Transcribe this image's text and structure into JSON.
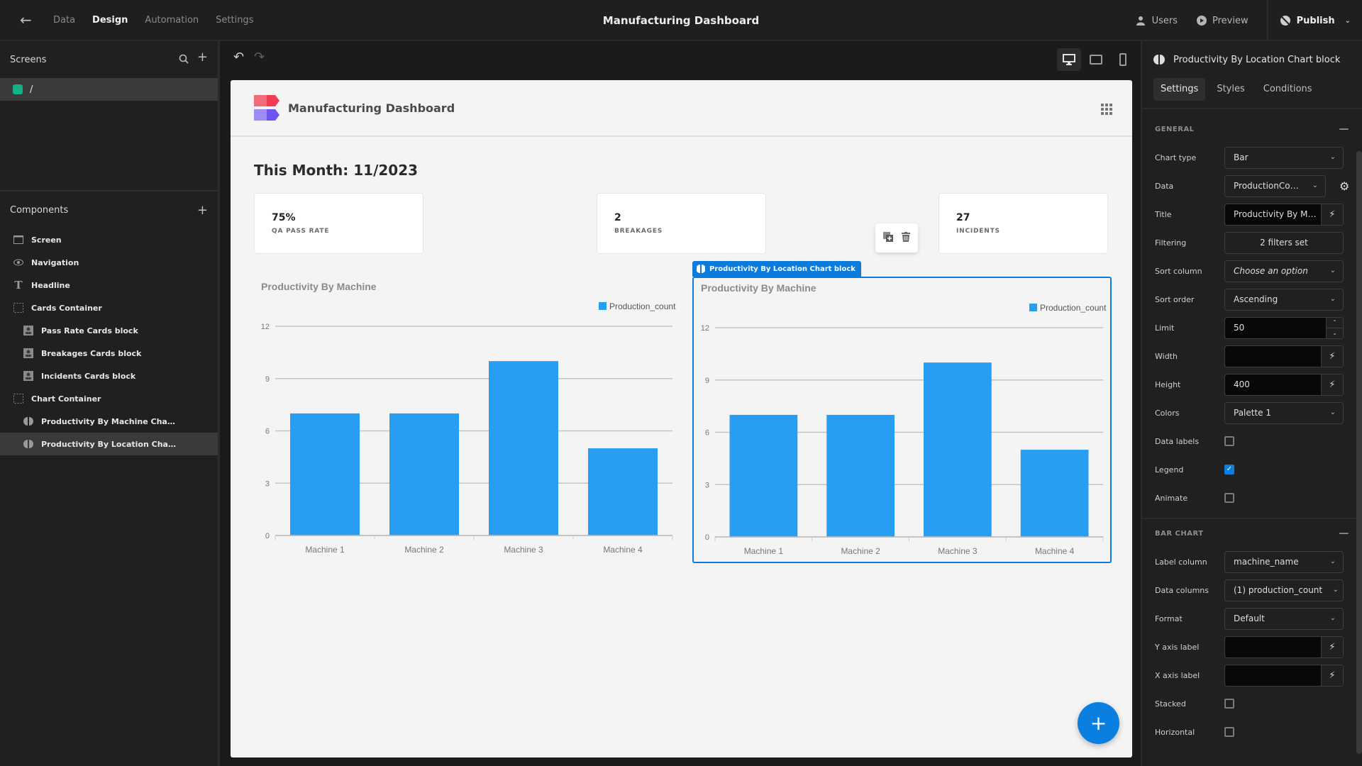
{
  "topbar": {
    "tabs": [
      "Data",
      "Design",
      "Automation",
      "Settings"
    ],
    "active_tab": "Design",
    "title": "Manufacturing Dashboard",
    "users_label": "Users",
    "preview_label": "Preview",
    "publish_label": "Publish"
  },
  "left_panel": {
    "screens_title": "Screens",
    "screens": [
      {
        "label": "/",
        "color": "#13b08a"
      }
    ],
    "components_title": "Components",
    "components": [
      {
        "label": "Screen",
        "icon": "screen-icon",
        "level": 1
      },
      {
        "label": "Navigation",
        "icon": "eye-icon",
        "level": 1
      },
      {
        "label": "Headline",
        "icon": "text-icon",
        "level": 1
      },
      {
        "label": "Cards Container",
        "icon": "container-icon",
        "level": 1
      },
      {
        "label": "Pass Rate Cards block",
        "icon": "card-icon",
        "level": 2
      },
      {
        "label": "Breakages Cards block",
        "icon": "card-icon",
        "level": 2
      },
      {
        "label": "Incidents Cards block",
        "icon": "card-icon",
        "level": 2
      },
      {
        "label": "Chart Container",
        "icon": "container-icon",
        "level": 1
      },
      {
        "label": "Productivity By Machine Cha…",
        "icon": "chart-icon",
        "level": 2
      },
      {
        "label": "Productivity By Location Cha…",
        "icon": "chart-icon",
        "level": 2,
        "selected": true
      }
    ]
  },
  "app": {
    "name": "Manufacturing Dashboard",
    "month_heading": "This Month: 11/2023",
    "cards": [
      {
        "value": "75%",
        "label": "QA PASS RATE"
      },
      {
        "value": "2",
        "label": "BREAKAGES"
      },
      {
        "value": "27",
        "label": "INCIDENTS"
      }
    ],
    "selected_tag": "Productivity By Location Chart block",
    "accent": "#0b7bdc",
    "bar_color": "#279ef2"
  },
  "chart_data": [
    {
      "type": "bar",
      "title": "Productivity By Machine",
      "categories": [
        "Machine 1",
        "Machine 2",
        "Machine 3",
        "Machine 4"
      ],
      "series": [
        {
          "name": "Production_count",
          "values": [
            7,
            7,
            10,
            5
          ]
        }
      ],
      "ylim": [
        0,
        12
      ],
      "yticks": [
        0,
        3,
        6,
        9,
        12
      ],
      "xlabel": "",
      "ylabel": "",
      "legend": "top-right",
      "grid": true
    },
    {
      "type": "bar",
      "title": "Productivity By Machine",
      "categories": [
        "Machine 1",
        "Machine 2",
        "Machine 3",
        "Machine 4"
      ],
      "series": [
        {
          "name": "Production_count",
          "values": [
            7,
            7,
            10,
            5
          ]
        }
      ],
      "ylim": [
        0,
        12
      ],
      "yticks": [
        0,
        3,
        6,
        9,
        12
      ],
      "xlabel": "",
      "ylabel": "",
      "legend": "top-right",
      "grid": true
    }
  ],
  "right_panel": {
    "title": "Productivity By Location Chart block",
    "tabs": [
      "Settings",
      "Styles",
      "Conditions"
    ],
    "active_tab": "Settings",
    "general": {
      "heading": "GENERAL",
      "chart_type": {
        "label": "Chart type",
        "value": "Bar"
      },
      "data": {
        "label": "Data",
        "value": "ProductionCo…"
      },
      "title": {
        "label": "Title",
        "value": "Productivity By M…"
      },
      "filtering": {
        "label": "Filtering",
        "value": "2 filters set"
      },
      "sort_column": {
        "label": "Sort column",
        "placeholder": "Choose an option"
      },
      "sort_order": {
        "label": "Sort order",
        "value": "Ascending"
      },
      "limit": {
        "label": "Limit",
        "value": "50"
      },
      "width": {
        "label": "Width",
        "value": ""
      },
      "height": {
        "label": "Height",
        "value": "400"
      },
      "colors": {
        "label": "Colors",
        "value": "Palette 1"
      },
      "data_labels": {
        "label": "Data labels",
        "checked": false
      },
      "legend": {
        "label": "Legend",
        "checked": true
      },
      "animate": {
        "label": "Animate",
        "checked": false
      }
    },
    "bar_chart": {
      "heading": "BAR CHART",
      "label_column": {
        "label": "Label column",
        "value": "machine_name"
      },
      "data_columns": {
        "label": "Data columns",
        "value": "(1) production_count"
      },
      "format": {
        "label": "Format",
        "value": "Default"
      },
      "y_axis_label": {
        "label": "Y axis label",
        "value": ""
      },
      "x_axis_label": {
        "label": "X axis label",
        "value": ""
      },
      "stacked": {
        "label": "Stacked",
        "checked": false
      },
      "horizontal": {
        "label": "Horizontal",
        "checked": false
      }
    }
  }
}
